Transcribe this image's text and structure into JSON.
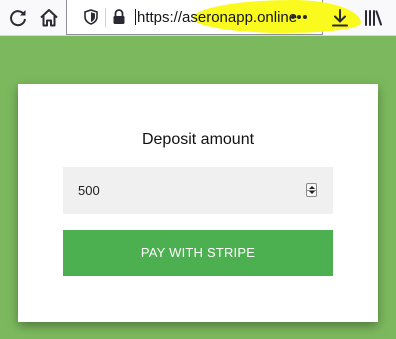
{
  "browser": {
    "url": "https://aseronapp.online",
    "icons": [
      "reload-icon",
      "home-icon",
      "shield-icon",
      "lock-icon",
      "more-actions-icon",
      "downloads-icon",
      "library-icon"
    ],
    "highlight_color": "#fafa1e"
  },
  "page": {
    "background_color": "#7cb95e",
    "title": "Deposit amount",
    "amount_value": "500",
    "pay_label": "PAY WITH STRIPE",
    "button_color": "#4caf50"
  }
}
